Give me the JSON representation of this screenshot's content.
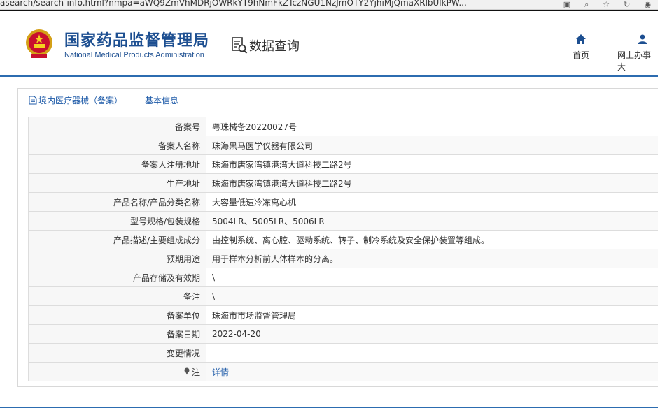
{
  "browser": {
    "url": "asearch/search-info.html?nmpa=aWQ9ZmVhMDRjOWRkYT9hNmFkZTczNGU1NzJmOTY2YjhiMjQmaXRlbUlkPW..."
  },
  "header": {
    "cn_title": "国家药品监督管理局",
    "en_title": "National Medical Products Administration",
    "search_title": "数据查询",
    "nav": [
      {
        "label": "首页",
        "icon": "home-icon"
      },
      {
        "label": "网上办事大",
        "icon": "user-icon"
      }
    ]
  },
  "breadcrumb": {
    "part1": "境内医疗器械（备案）",
    "sep": "——",
    "part2": "基本信息"
  },
  "rows": [
    {
      "label": "备案号",
      "value": "粤珠械备20220027号"
    },
    {
      "label": "备案人名称",
      "value": "珠海黑马医学仪器有限公司"
    },
    {
      "label": "备案人注册地址",
      "value": "珠海市唐家湾镇港湾大道科技二路2号"
    },
    {
      "label": "生产地址",
      "value": "珠海市唐家湾镇港湾大道科技二路2号"
    },
    {
      "label": "产品名称/产品分类名称",
      "value": "大容量低速冷冻离心机"
    },
    {
      "label": "型号规格/包装规格",
      "value": "5004LR、5005LR、5006LR"
    },
    {
      "label": "产品描述/主要组成成分",
      "value": "由控制系统、离心腔、驱动系统、转子、制冷系统及安全保护装置等组成。"
    },
    {
      "label": "预期用途",
      "value": "用于样本分析前人体样本的分离。"
    },
    {
      "label": "产品存储及有效期",
      "value": "\\"
    },
    {
      "label": "备注",
      "value": "\\"
    },
    {
      "label": "备案单位",
      "value": "珠海市市场监督管理局"
    },
    {
      "label": "备案日期",
      "value": "2022-04-20"
    },
    {
      "label": "变更情况",
      "value": ""
    }
  ],
  "note_row": {
    "label": "注",
    "link": "详情"
  },
  "colors": {
    "brand_blue": "#1d4f91",
    "link_blue": "#1d5aa8",
    "accent_line": "#2c6cb0"
  }
}
